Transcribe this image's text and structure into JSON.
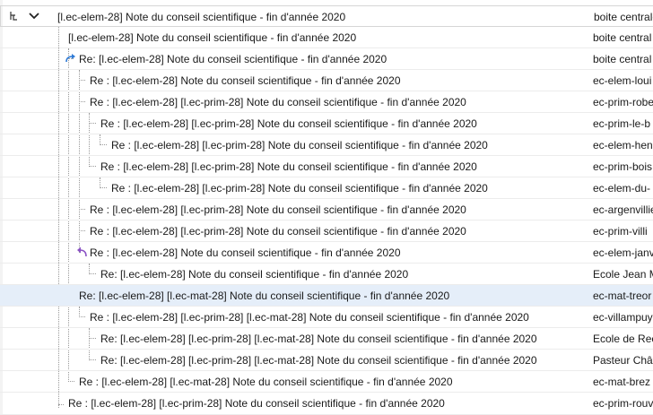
{
  "rows": [
    {
      "subject": "[l.ec-elem-28] Note du conseil scientifique - fin d'année 2020",
      "correspondent": "boite centrale"
    },
    {
      "subject": "[l.ec-elem-28] Note du conseil scientifique - fin d'année 2020",
      "correspondent": "boite central"
    },
    {
      "subject": "Re: [l.ec-elem-28] Note du conseil scientifique - fin d'année 2020",
      "correspondent": "boite central"
    },
    {
      "subject": "Re : [l.ec-elem-28] Note du conseil scientifique - fin d'année 2020",
      "correspondent": "ec-elem-loui"
    },
    {
      "subject": "Re : [l.ec-elem-28] [l.ec-prim-28] Note du conseil scientifique - fin d'année 2020",
      "correspondent": "ec-prim-robe"
    },
    {
      "subject": "Re : [l.ec-elem-28] [l.ec-prim-28] Note du conseil scientifique - fin d'année 2020",
      "correspondent": "ec-prim-le-b"
    },
    {
      "subject": "Re : [l.ec-elem-28] [l.ec-prim-28] Note du conseil scientifique - fin d'année 2020",
      "correspondent": "ec-elem-hen"
    },
    {
      "subject": "Re : [l.ec-elem-28] [l.ec-prim-28] Note du conseil scientifique - fin d'année 2020",
      "correspondent": "ec-prim-bois"
    },
    {
      "subject": "Re : [l.ec-elem-28] [l.ec-prim-28] Note du conseil scientifique - fin d'année 2020",
      "correspondent": "ec-elem-du-"
    },
    {
      "subject": "Re : [l.ec-elem-28] [l.ec-prim-28] Note du conseil scientifique - fin d'année 2020",
      "correspondent": "ec-argenvillie"
    },
    {
      "subject": "Re : [l.ec-elem-28] [l.ec-prim-28] Note du conseil scientifique - fin d'année 2020",
      "correspondent": "ec-prim-villi"
    },
    {
      "subject": "Re : [l.ec-elem-28] Note du conseil scientifique - fin d'année 2020",
      "correspondent": "ec-elem-janv"
    },
    {
      "subject": "Re: [l.ec-elem-28] Note du conseil scientifique - fin d'année 2020",
      "correspondent": "Ecole Jean M"
    },
    {
      "subject": "Re: [l.ec-elem-28] [l.ec-mat-28] Note du conseil scientifique - fin d'année 2020",
      "correspondent": "ec-mat-treor"
    },
    {
      "subject": "Re : [l.ec-elem-28] [l.ec-prim-28] [l.ec-mat-28] Note du conseil scientifique - fin d'année 2020",
      "correspondent": "ec-villampuy"
    },
    {
      "subject": "Re: [l.ec-elem-28] [l.ec-prim-28] [l.ec-mat-28] Note du conseil scientifique - fin d'année 2020",
      "correspondent": "Ecole de Rec"
    },
    {
      "subject": "Re: [l.ec-elem-28] [l.ec-prim-28] [l.ec-mat-28] Note du conseil scientifique - fin d'année 2020",
      "correspondent": "Pasteur Chât"
    },
    {
      "subject": "Re : [l.ec-elem-28] [l.ec-mat-28] Note du conseil scientifique - fin d'année 2020",
      "correspondent": "ec-mat-brez"
    },
    {
      "subject": "Re : [l.ec-elem-28] [l.ec-prim-28] Note du conseil scientifique - fin d'année 2020",
      "correspondent": "ec-prim-rouv"
    }
  ],
  "icons": {
    "thread": "thread-icon",
    "collapse": "chevron-down-icon",
    "forwarded": "forwarded-arrow-icon",
    "replied": "replied-arrow-icon"
  },
  "colors": {
    "selected_row": "#e5eef9",
    "forwarded_icon": "#2f7bd6",
    "replied_icon": "#8a52c4"
  }
}
